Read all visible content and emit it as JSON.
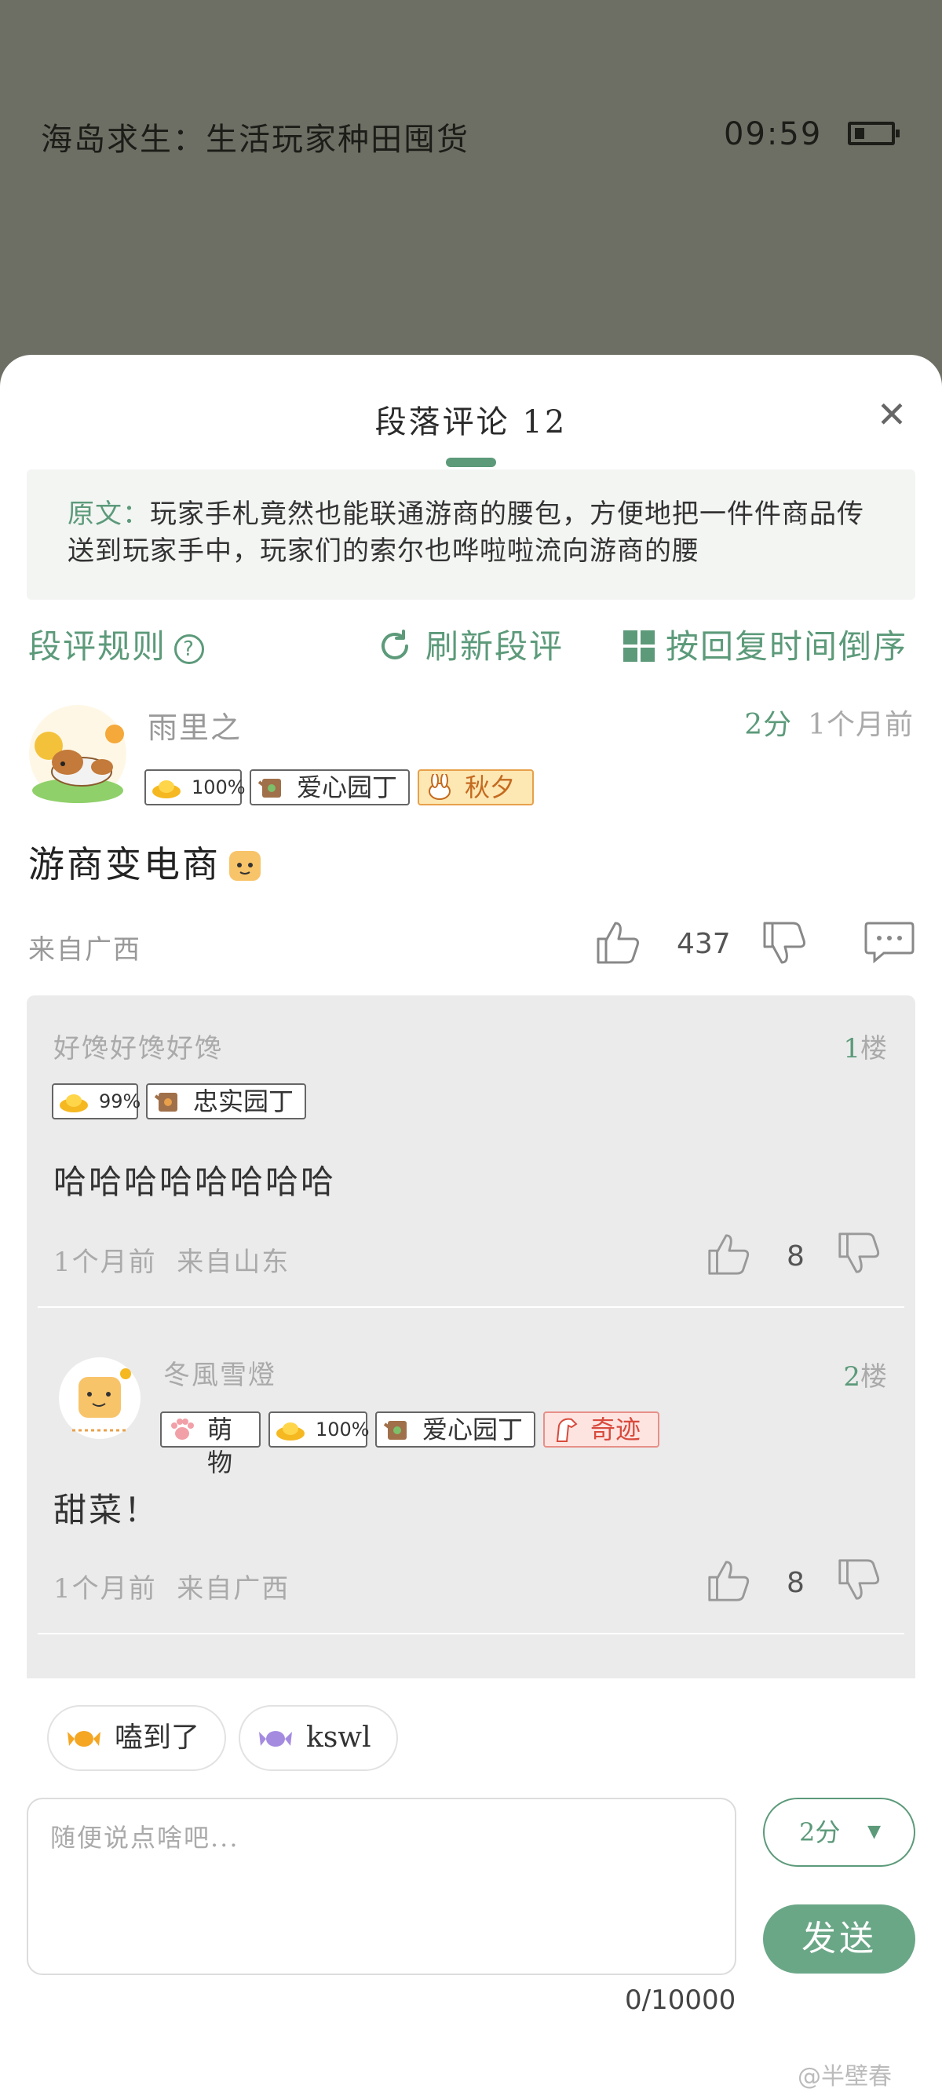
{
  "reader": {
    "book_title": "海岛求生：生活玩家种田囤货",
    "time": "09:59"
  },
  "sheet": {
    "title": "段落评论 12",
    "quote_label": "原文：",
    "quote_text": "玩家手札竟然也能联通游商的腰包，方便地把一件件商品传送到玩家手中，玩家们的索尔也哗啦啦流向游商的腰"
  },
  "toolbar": {
    "rules": "段评规则",
    "refresh": "刷新段评",
    "sort": "按回复时间倒序"
  },
  "comment": {
    "username": "雨里之",
    "score": "2分",
    "time": "1个月前",
    "badges": [
      "100%",
      "爱心园丁",
      "秋夕"
    ],
    "text": "游商变电商",
    "location": "来自广西",
    "likes": "437"
  },
  "replies": [
    {
      "username": "好馋好馋好馋",
      "floor_num": "1",
      "floor_suffix": "楼",
      "badges": [
        "99%",
        "忠实园丁"
      ],
      "text": "哈哈哈哈哈哈哈哈",
      "time": "1个月前",
      "location": "来自山东",
      "likes": "8"
    },
    {
      "username": "冬風雪燈",
      "floor_num": "2",
      "floor_suffix": "楼",
      "badges": [
        "萌物",
        "100%",
        "爱心园丁",
        "奇迹"
      ],
      "text": "甜菜！",
      "time": "1个月前",
      "location": "来自广西",
      "likes": "8"
    }
  ],
  "reactions": [
    "嗑到了",
    "kswl"
  ],
  "composer": {
    "placeholder": "随便说点啥吧...",
    "char_count": "0/10000",
    "score_value": "2分",
    "send_label": "发送"
  },
  "watermark": "@半壁春",
  "colors": {
    "accent": "#5c9a7a",
    "send_button": "#6aa787",
    "overlay": "#6e6f64"
  }
}
